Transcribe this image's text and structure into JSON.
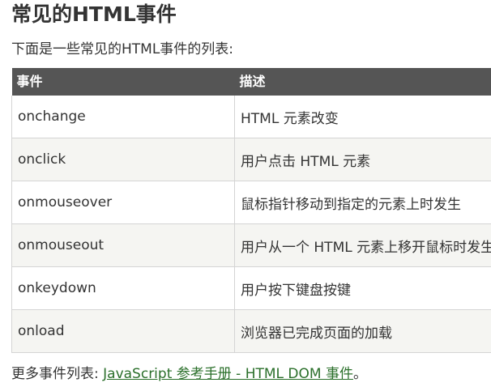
{
  "page": {
    "title": "常见的HTML事件",
    "intro": "下面是一些常见的HTML事件的列表:",
    "link_color": "#2a6f2a",
    "header_color": "#555555"
  },
  "table": {
    "headers": [
      "事件",
      "描述"
    ],
    "rows": [
      {
        "event": "onchange",
        "description": "HTML 元素改变"
      },
      {
        "event": "onclick",
        "description": "用户点击 HTML 元素"
      },
      {
        "event": "onmouseover",
        "description": "鼠标指针移动到指定的元素上时发生"
      },
      {
        "event": "onmouseout",
        "description": "用户从一个 HTML 元素上移开鼠标时发生"
      },
      {
        "event": "onkeydown",
        "description": "用户按下键盘按键"
      },
      {
        "event": "onload",
        "description": "浏览器已完成页面的加载"
      }
    ]
  },
  "footer": {
    "prefix": "更多事件列表: ",
    "link_text": "JavaScript 参考手册 - HTML DOM 事件",
    "suffix": "。"
  }
}
